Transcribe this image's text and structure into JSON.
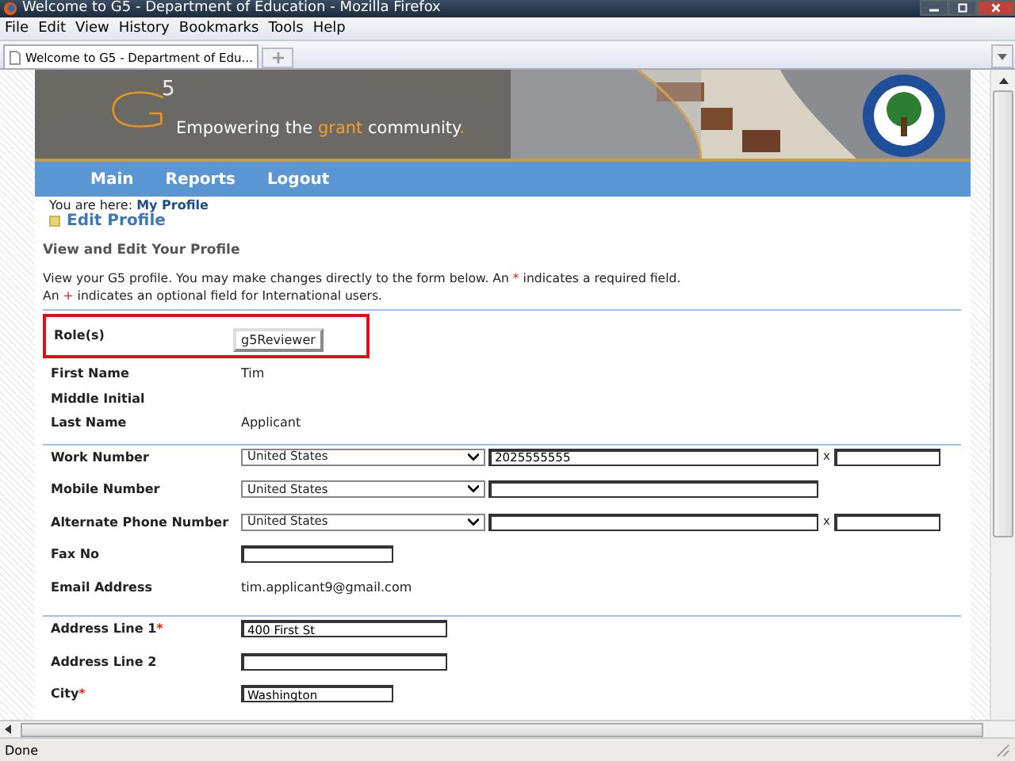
{
  "window": {
    "title": "Welcome to G5 - Department of Education - Mozilla Firefox"
  },
  "menu": [
    "File",
    "Edit",
    "View",
    "History",
    "Bookmarks",
    "Tools",
    "Help"
  ],
  "tabs": [
    {
      "label": "Welcome to G5 - Department of Edu...",
      "selected": true
    }
  ],
  "banner": {
    "kind": "picture",
    "logo_digit": "5",
    "tagline": [
      {
        "text": "Empowering the ",
        "kind": "plain"
      },
      {
        "text": "grant",
        "kind": "accent"
      },
      {
        "text": " community",
        "kind": "plain"
      },
      {
        "text": ".",
        "kind": "accent"
      }
    ]
  },
  "nav": [
    "Main",
    "Reports",
    "Logout"
  ],
  "breadcrumb": {
    "prefix": "You are here:",
    "link": "My Profile"
  },
  "page_title": "Edit Profile",
  "section_title": "View and Edit Your Profile",
  "intro": [
    [
      {
        "text": "View your G5 profile. You may make changes directly to the form below. An ",
        "kind": "plain"
      },
      {
        "text": "*",
        "kind": "mark"
      },
      {
        "text": " indicates a required field.",
        "kind": "plain"
      }
    ],
    [
      {
        "text": "An ",
        "kind": "plain"
      },
      {
        "text": "+",
        "kind": "mark"
      },
      {
        "text": " indicates an optional field for International users.",
        "kind": "plain"
      }
    ]
  ],
  "roles": {
    "label": "Role(s)",
    "values": [
      "g5Reviewer"
    ],
    "highlighted": true
  },
  "groups": [
    [
      {
        "label": "First Name",
        "kind": "static",
        "value": "Tim"
      },
      {
        "label": "Middle Initial",
        "kind": "static"
      },
      {
        "label": "Last Name",
        "kind": "static",
        "value": "Applicant"
      }
    ],
    [
      {
        "label": "Work Number",
        "kind": "phone",
        "country": "United States",
        "value": "2025555555",
        "ext_sep": "x"
      },
      {
        "label": "Mobile Number",
        "kind": "phone",
        "country": "United States"
      },
      {
        "label": "Alternate Phone Number",
        "kind": "phone",
        "country": "United States",
        "ext_sep": "x"
      },
      {
        "label": "Fax No",
        "kind": "input"
      },
      {
        "label": "Email Address",
        "kind": "static",
        "value": "tim.applicant9@gmail.com"
      }
    ],
    [
      {
        "label": "Address Line 1",
        "kind": "input",
        "required": true,
        "value": "400 First St",
        "wide": true
      },
      {
        "label": "Address Line 2",
        "kind": "input",
        "wide": true
      },
      {
        "label": "City",
        "kind": "input",
        "required": true,
        "value": "Washington"
      }
    ]
  ],
  "status_bar": "Done"
}
